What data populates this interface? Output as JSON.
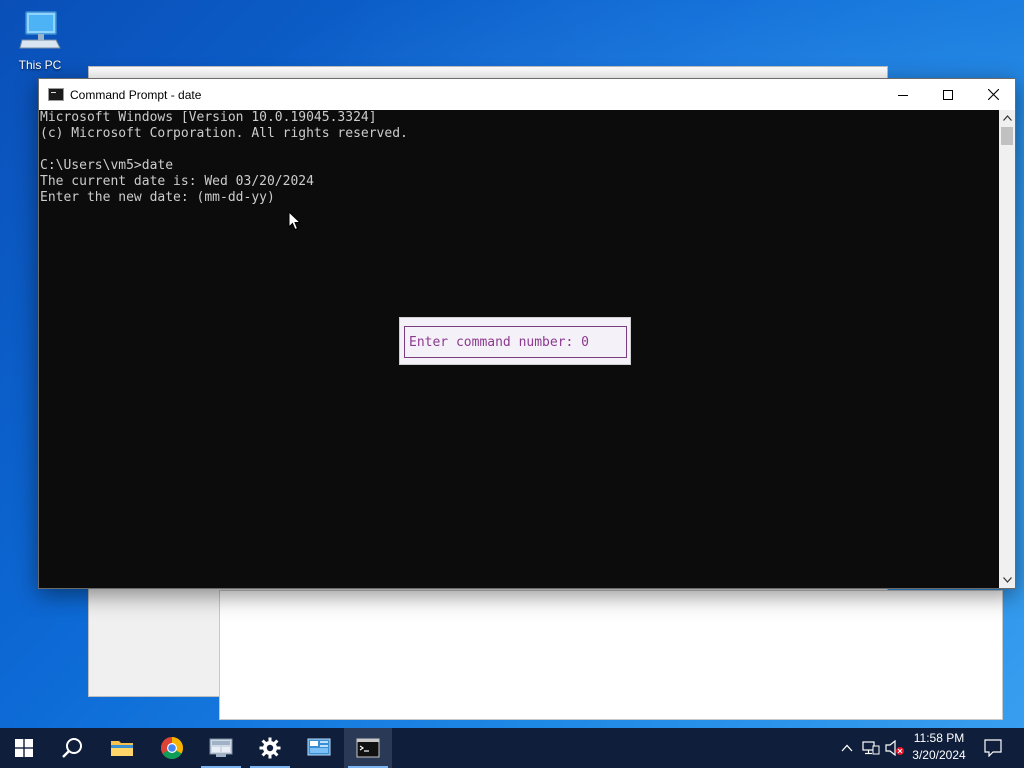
{
  "desktop": {
    "icons": [
      {
        "label": "This PC",
        "icon": "computer-icon"
      }
    ]
  },
  "cmd_window": {
    "title": "Command Prompt - date",
    "icon": "cmd-icon",
    "controls": {
      "minimize": "minimize-icon",
      "maximize": "maximize-icon",
      "close": "close-icon"
    },
    "lines": [
      "Microsoft Windows [Version 10.0.19045.3324]",
      "(c) Microsoft Corporation. All rights reserved.",
      "",
      "C:\\Users\\vm5>date",
      "The current date is: Wed 03/20/2024",
      "Enter the new date: (mm-dd-yy)"
    ],
    "text_color": "#cccccc",
    "background_color": "#0c0c0c"
  },
  "popup": {
    "text": "Enter command number: 0",
    "text_color": "#8b3a8f"
  },
  "taskbar": {
    "items": [
      {
        "name": "start-button",
        "icon": "windows-logo-icon",
        "running": false
      },
      {
        "name": "search-button",
        "icon": "search-icon",
        "running": false
      },
      {
        "name": "file-explorer",
        "icon": "folder-icon",
        "running": false
      },
      {
        "name": "chrome",
        "icon": "chrome-icon",
        "running": false
      },
      {
        "name": "network-app",
        "icon": "network-window-icon",
        "running": true
      },
      {
        "name": "settings",
        "icon": "gear-icon",
        "running": true
      },
      {
        "name": "control-panel",
        "icon": "control-panel-icon",
        "running": false
      },
      {
        "name": "command-prompt",
        "icon": "cmd-icon",
        "running": true,
        "active": true
      }
    ],
    "tray": {
      "icons": [
        "chevron-up-icon",
        "network-icon",
        "volume-muted-icon"
      ],
      "time": "11:58 PM",
      "date": "3/20/2024",
      "notification_icon": "notification-icon"
    }
  }
}
